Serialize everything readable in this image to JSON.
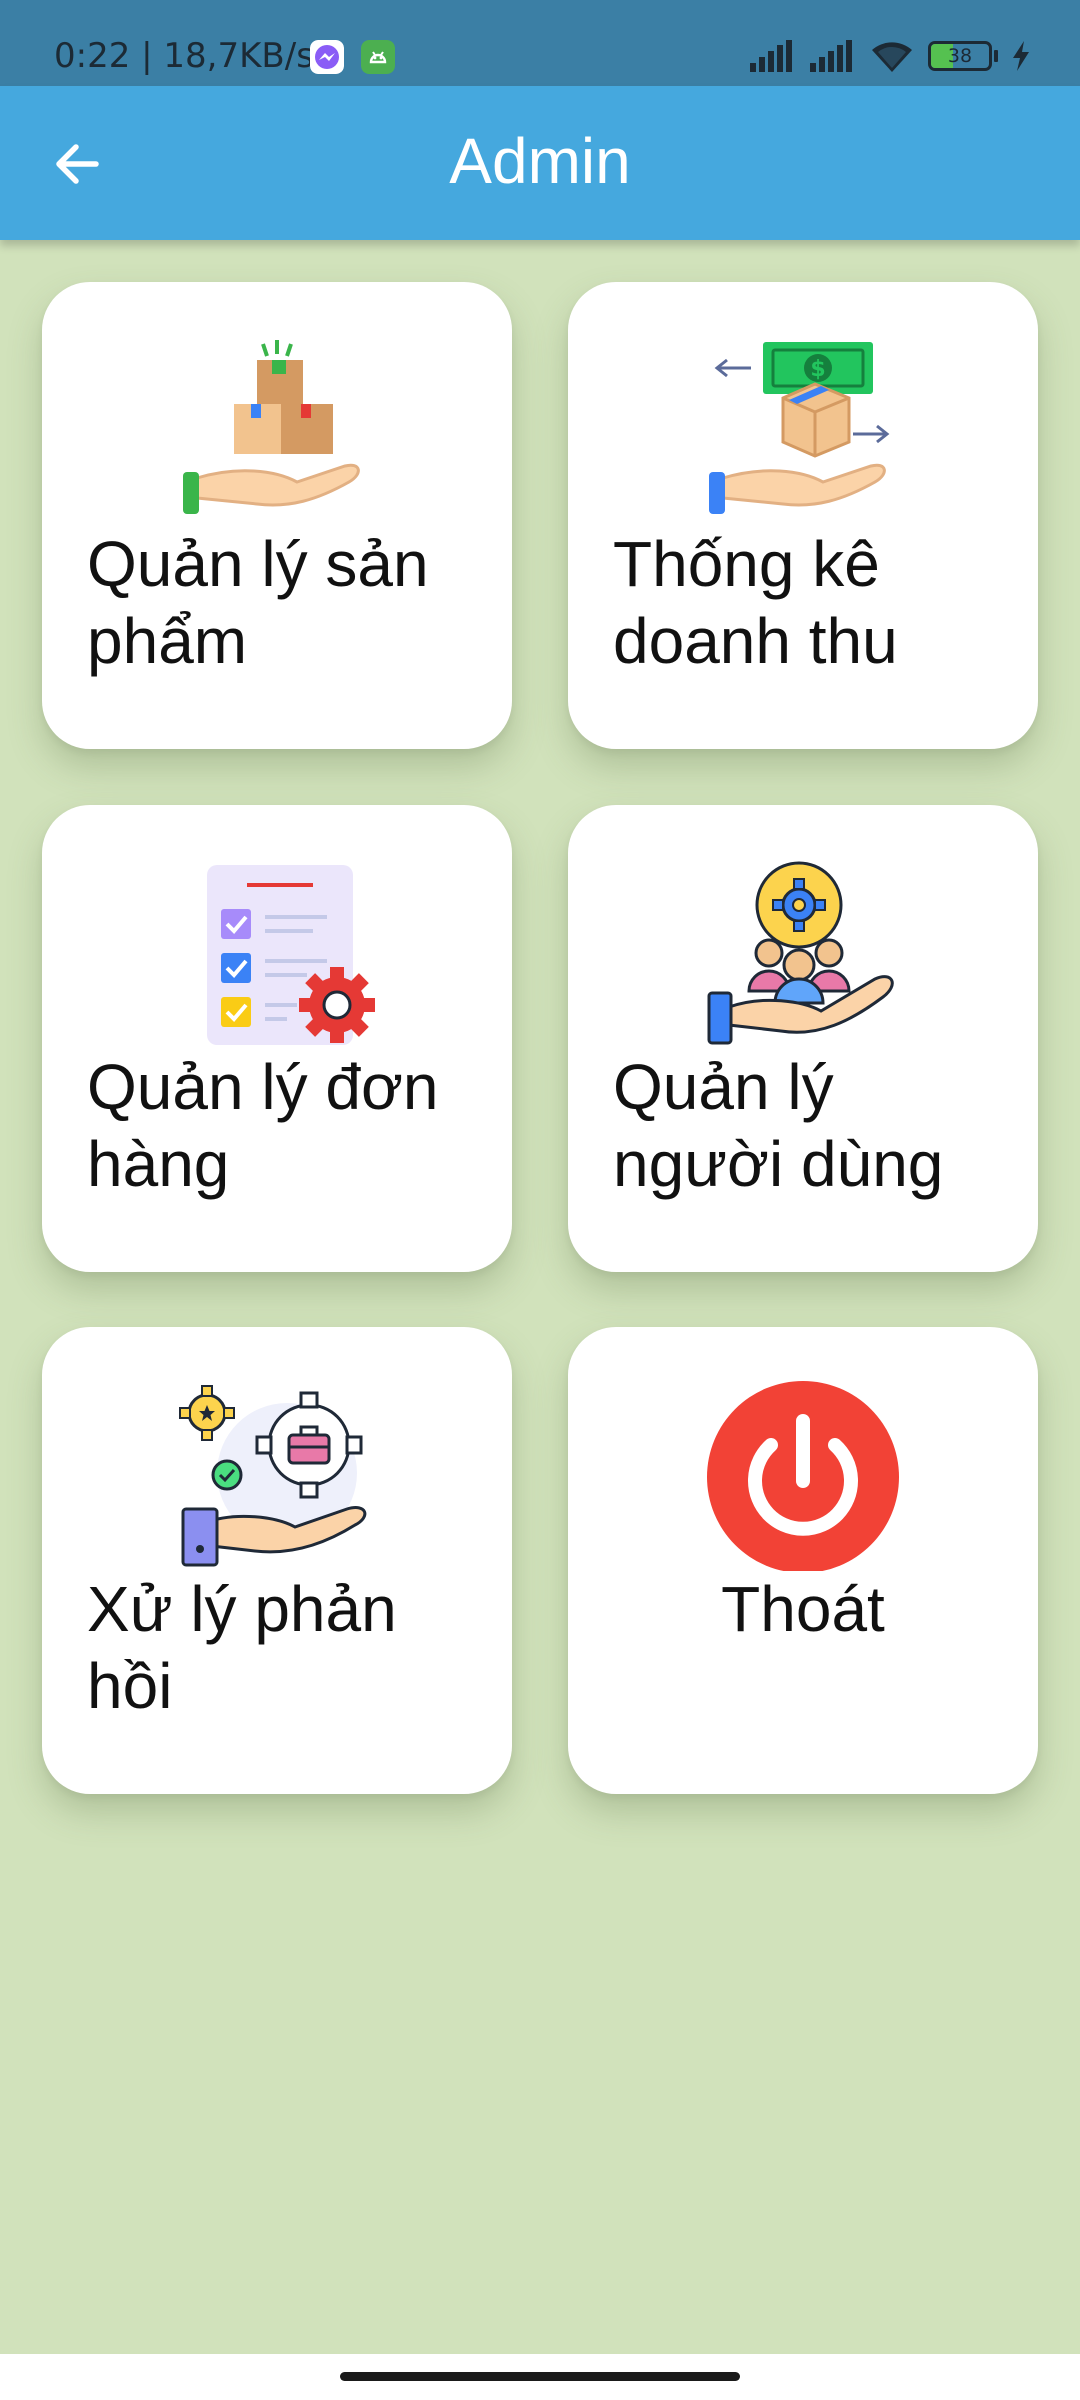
{
  "status_bar": {
    "time_speed": "0:22 | 18,7KB/s",
    "battery_level": "38",
    "battery_fraction": 0.38
  },
  "app_bar": {
    "title": "Admin",
    "back_icon": "arrow-left-icon"
  },
  "menu": [
    {
      "id": "products",
      "label": "Quản lý sản phẩm",
      "icon": "boxes-on-hand-icon"
    },
    {
      "id": "revenue",
      "label": "Thống kê doanh thu",
      "icon": "money-exchange-hand-icon"
    },
    {
      "id": "orders",
      "label": "Quản lý đơn hàng",
      "icon": "checklist-gear-icon"
    },
    {
      "id": "users",
      "label": "Quản lý người dùng",
      "icon": "people-hand-gear-icon"
    },
    {
      "id": "feedback",
      "label": "Xử lý phản hồi",
      "icon": "gears-briefcase-hand-icon"
    },
    {
      "id": "logout",
      "label": "Thoát",
      "icon": "power-icon"
    }
  ],
  "colors": {
    "status_bar": "#3b7fa5",
    "app_bar": "#45a8de",
    "background": "#d1e2bb",
    "card": "#ffffff",
    "logout_red": "#f24236"
  }
}
